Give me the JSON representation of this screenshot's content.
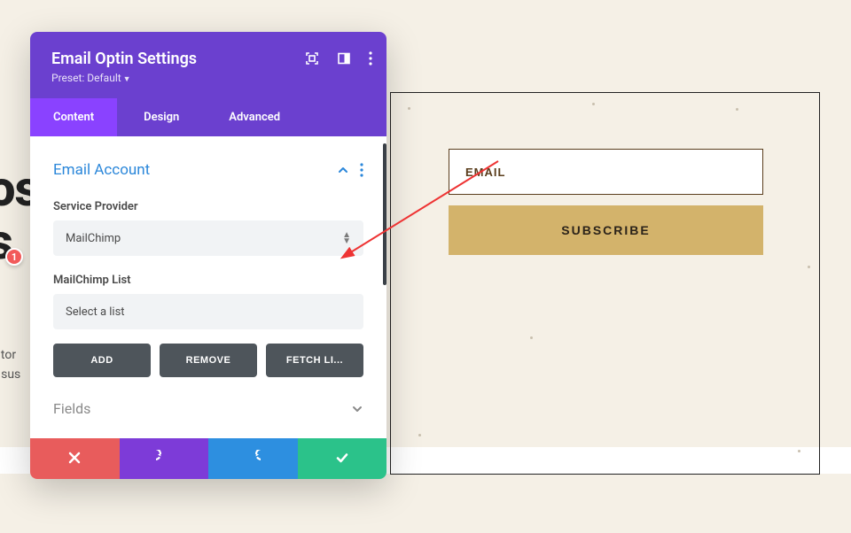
{
  "bg": {
    "line1": "os",
    "line2": "s",
    "para1": "e tor",
    "para2": "a sus"
  },
  "form": {
    "email_placeholder": "EMAIL",
    "subscribe_label": "SUBSCRIBE"
  },
  "modal": {
    "title": "Email Optin Settings",
    "preset_prefix": "Preset: ",
    "preset_value": "Default",
    "tabs": {
      "content": "Content",
      "design": "Design",
      "advanced": "Advanced"
    },
    "section": {
      "title": "Email Account",
      "provider_label": "Service Provider",
      "provider_value": "MailChimp",
      "list_label": "MailChimp List",
      "list_value": "Select a list",
      "add_label": "ADD",
      "remove_label": "REMOVE",
      "fetch_label": "FETCH LI..."
    },
    "collapsed": {
      "title": "Fields"
    }
  },
  "annotation": {
    "badge": "1"
  }
}
